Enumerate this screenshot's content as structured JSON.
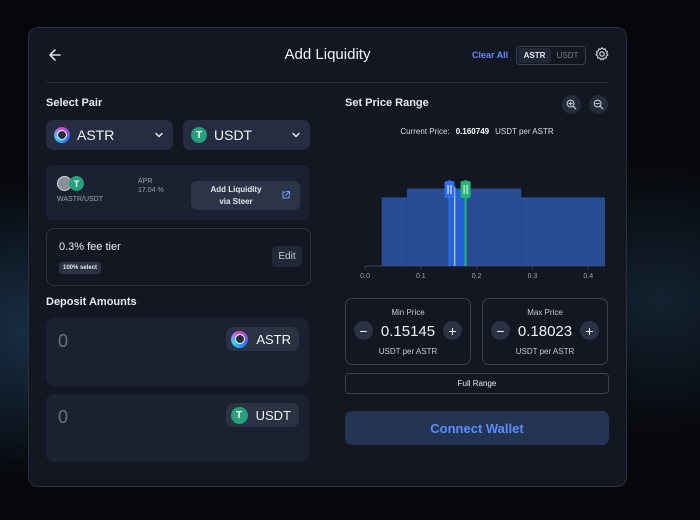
{
  "header": {
    "title": "Add Liquidity",
    "clear_all": "Clear All",
    "token_toggle": [
      "ASTR",
      "USDT"
    ],
    "selected_token": "ASTR",
    "back_icon": "arrow-left-icon",
    "settings_icon": "gear-icon"
  },
  "pair": {
    "label": "Select Pair",
    "token_a": "ASTR",
    "token_b": "USDT"
  },
  "steer": {
    "pair_name": "WASTR/USDT",
    "apr_label": "APR",
    "apr_value": "17.04 %",
    "button_line1": "Add Liquidity",
    "button_line2": "via Steer"
  },
  "fee": {
    "title": "0.3% fee tier",
    "badge": "100% select",
    "edit_label": "Edit"
  },
  "deposit": {
    "label": "Deposit Amounts",
    "items": [
      {
        "amount": "0",
        "token": "ASTR"
      },
      {
        "amount": "0",
        "token": "USDT"
      }
    ]
  },
  "price_range": {
    "label": "Set Price Range",
    "current_price_label": "Current Price:",
    "current_price_value": "0.160749",
    "current_price_unit": "USDT per ASTR",
    "min": {
      "label": "Min Price",
      "value": "0.15145",
      "unit": "USDT per ASTR"
    },
    "max": {
      "label": "Max Price",
      "value": "0.18023",
      "unit": "USDT per ASTR"
    },
    "full_range": "Full Range"
  },
  "connect_wallet": "Connect Wallet",
  "chart_data": {
    "type": "area",
    "x_ticks": [
      "0.0",
      "0.1",
      "0.2",
      "0.3",
      "0.4"
    ],
    "xlim": [
      0.0,
      0.43
    ],
    "liquidity": [
      {
        "x0": 0.0,
        "x1": 0.03,
        "level": 0.0
      },
      {
        "x0": 0.03,
        "x1": 0.075,
        "level": 0.78
      },
      {
        "x0": 0.075,
        "x1": 0.28,
        "level": 0.88
      },
      {
        "x0": 0.28,
        "x1": 0.43,
        "level": 0.78
      }
    ],
    "current_price": 0.160749,
    "range_min": 0.15145,
    "range_max": 0.18023,
    "colors": {
      "liquidity": "#2a4c92",
      "selected": "#2360d1",
      "min_handle": "#2f6ee8",
      "max_handle": "#22b573",
      "current": "#e6e8ee"
    }
  }
}
